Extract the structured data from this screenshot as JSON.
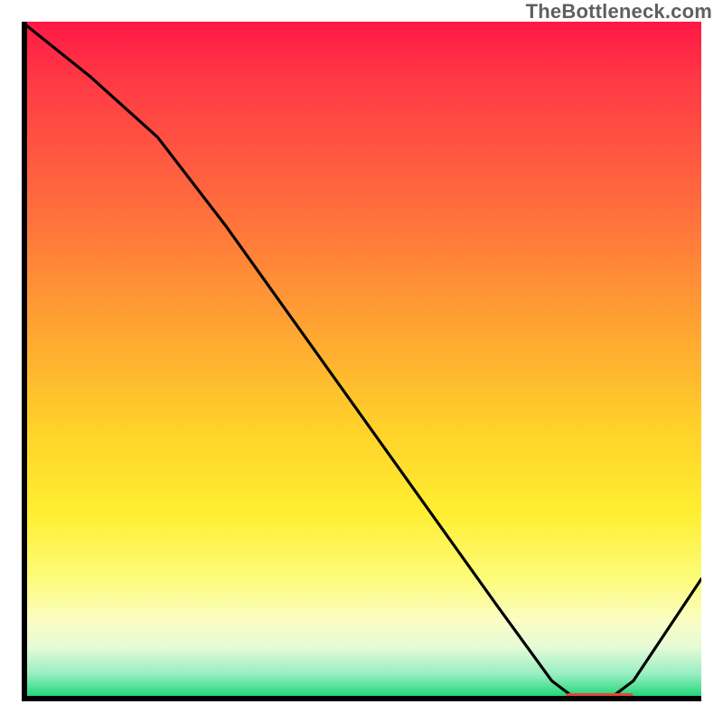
{
  "watermark": "TheBottleneck.com",
  "colors": {
    "line": "#000000",
    "marker": "#e2493a",
    "axis": "#000000"
  },
  "chart_data": {
    "type": "line",
    "title": "",
    "xlabel": "",
    "ylabel": "",
    "xlim": [
      0,
      100
    ],
    "ylim": [
      0,
      100
    ],
    "x": [
      0,
      10,
      20,
      30,
      40,
      50,
      60,
      70,
      78,
      82,
      86,
      90,
      100
    ],
    "values": [
      100,
      92,
      83,
      70,
      56,
      42,
      28,
      14,
      3,
      0,
      0,
      3,
      18
    ],
    "optimal_range_x": [
      80,
      90
    ],
    "optimal_range_y": 0,
    "annotations": []
  }
}
